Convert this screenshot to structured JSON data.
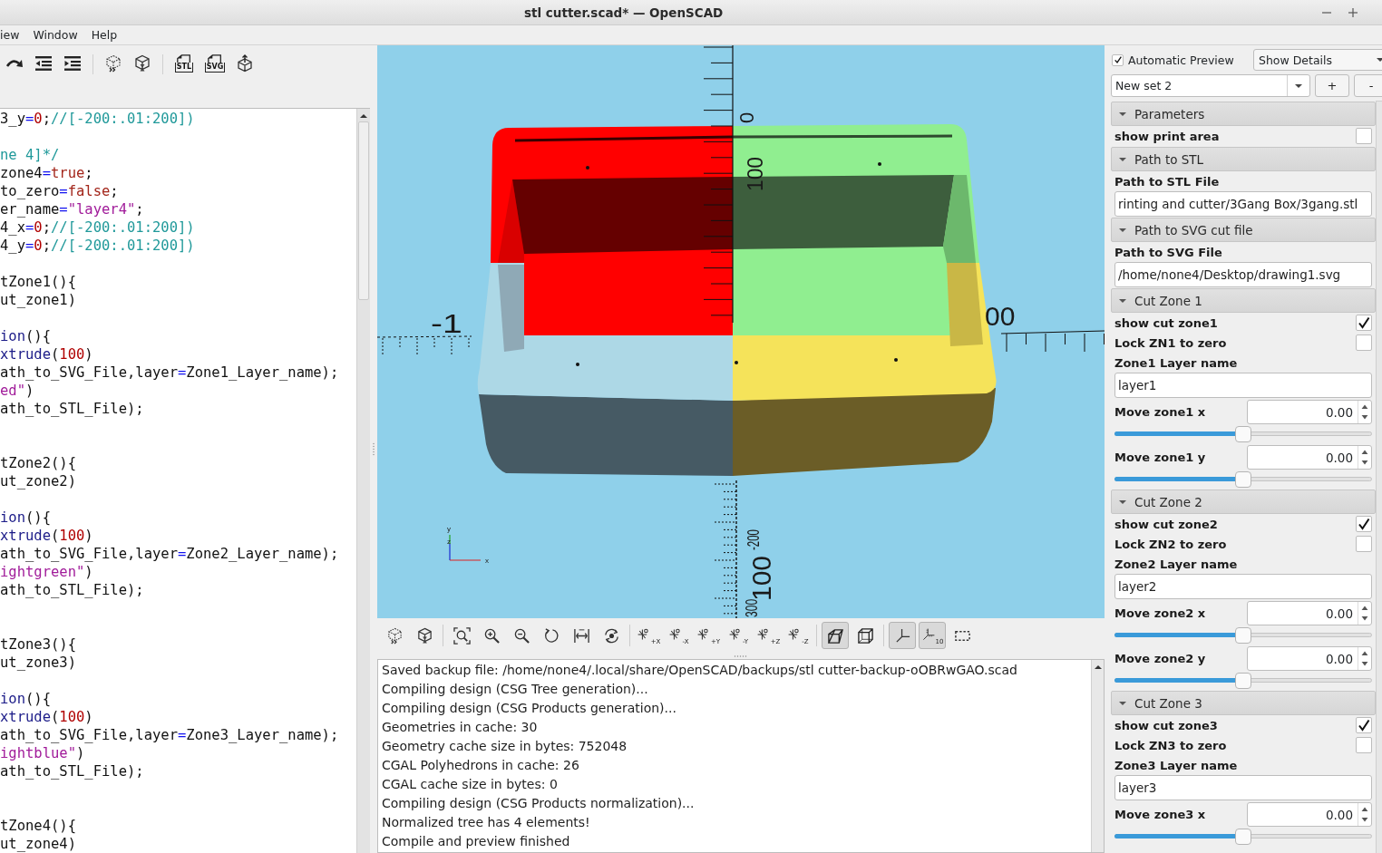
{
  "window": {
    "title": "stl cutter.scad* — OpenSCAD"
  },
  "menu": [
    {
      "label": "iew"
    },
    {
      "label": "Window"
    },
    {
      "label": "Help"
    }
  ],
  "editor_toolbar": {
    "export_labels": [
      "STL",
      "SVG"
    ]
  },
  "editor": {
    "lines": [
      {
        "kind": "code",
        "tokens": [
          {
            "kind": "plain",
            "text": "3_y"
          },
          {
            "kind": "operator",
            "text": "="
          },
          {
            "kind": "number",
            "text": "0"
          },
          {
            "kind": "plain",
            "text": ";"
          },
          {
            "kind": "comment",
            "text": "//[-200:.01:200])"
          }
        ]
      },
      {
        "kind": "blank"
      },
      {
        "kind": "code",
        "tokens": [
          {
            "kind": "comment",
            "text": "ne 4]*/"
          }
        ]
      },
      {
        "kind": "code",
        "tokens": [
          {
            "kind": "plain",
            "text": "zone4"
          },
          {
            "kind": "operator",
            "text": "="
          },
          {
            "kind": "keyword",
            "text": "true"
          },
          {
            "kind": "plain",
            "text": ";"
          }
        ]
      },
      {
        "kind": "code",
        "tokens": [
          {
            "kind": "plain",
            "text": "to_zero"
          },
          {
            "kind": "operator",
            "text": "="
          },
          {
            "kind": "keyword",
            "text": "false"
          },
          {
            "kind": "plain",
            "text": ";"
          }
        ]
      },
      {
        "kind": "code",
        "tokens": [
          {
            "kind": "plain",
            "text": "er_name"
          },
          {
            "kind": "operator",
            "text": "="
          },
          {
            "kind": "string",
            "text": "\"layer4\""
          },
          {
            "kind": "plain",
            "text": ";"
          }
        ]
      },
      {
        "kind": "code",
        "tokens": [
          {
            "kind": "plain",
            "text": "4_x"
          },
          {
            "kind": "operator",
            "text": "="
          },
          {
            "kind": "number",
            "text": "0"
          },
          {
            "kind": "plain",
            "text": ";"
          },
          {
            "kind": "comment",
            "text": "//[-200:.01:200])"
          }
        ]
      },
      {
        "kind": "code",
        "tokens": [
          {
            "kind": "plain",
            "text": "4_y"
          },
          {
            "kind": "operator",
            "text": "="
          },
          {
            "kind": "number",
            "text": "0"
          },
          {
            "kind": "plain",
            "text": ";"
          },
          {
            "kind": "comment",
            "text": "//[-200:.01:200])"
          }
        ]
      },
      {
        "kind": "blank"
      },
      {
        "kind": "code",
        "tokens": [
          {
            "kind": "plain",
            "text": "tZone1(){"
          }
        ]
      },
      {
        "kind": "code",
        "tokens": [
          {
            "kind": "plain",
            "text": "ut_zone1)"
          }
        ]
      },
      {
        "kind": "blank"
      },
      {
        "kind": "code",
        "tokens": [
          {
            "kind": "builtin",
            "text": "ion"
          },
          {
            "kind": "plain",
            "text": "(){"
          }
        ]
      },
      {
        "kind": "code",
        "tokens": [
          {
            "kind": "builtin",
            "text": "xtrude"
          },
          {
            "kind": "plain",
            "text": "("
          },
          {
            "kind": "number",
            "text": "100"
          },
          {
            "kind": "plain",
            "text": ")"
          }
        ]
      },
      {
        "kind": "code",
        "tokens": [
          {
            "kind": "plain",
            "text": "ath_to_SVG_File,layer"
          },
          {
            "kind": "operator",
            "text": "="
          },
          {
            "kind": "plain",
            "text": "Zone1_Layer_name);"
          }
        ]
      },
      {
        "kind": "code",
        "tokens": [
          {
            "kind": "string",
            "text": "ed\""
          },
          {
            "kind": "plain",
            "text": ")"
          }
        ]
      },
      {
        "kind": "code",
        "tokens": [
          {
            "kind": "plain",
            "text": "ath_to_STL_File);"
          }
        ]
      },
      {
        "kind": "blank"
      },
      {
        "kind": "blank"
      },
      {
        "kind": "code",
        "tokens": [
          {
            "kind": "plain",
            "text": "tZone2(){"
          }
        ]
      },
      {
        "kind": "code",
        "tokens": [
          {
            "kind": "plain",
            "text": "ut_zone2)"
          }
        ]
      },
      {
        "kind": "blank"
      },
      {
        "kind": "code",
        "tokens": [
          {
            "kind": "builtin",
            "text": "ion"
          },
          {
            "kind": "plain",
            "text": "(){"
          }
        ]
      },
      {
        "kind": "code",
        "tokens": [
          {
            "kind": "builtin",
            "text": "xtrude"
          },
          {
            "kind": "plain",
            "text": "("
          },
          {
            "kind": "number",
            "text": "100"
          },
          {
            "kind": "plain",
            "text": ")"
          }
        ]
      },
      {
        "kind": "code",
        "tokens": [
          {
            "kind": "plain",
            "text": "ath_to_SVG_File,layer"
          },
          {
            "kind": "operator",
            "text": "="
          },
          {
            "kind": "plain",
            "text": "Zone2_Layer_name);"
          }
        ]
      },
      {
        "kind": "code",
        "tokens": [
          {
            "kind": "string",
            "text": "ightgreen\""
          },
          {
            "kind": "plain",
            "text": ")"
          }
        ]
      },
      {
        "kind": "code",
        "tokens": [
          {
            "kind": "plain",
            "text": "ath_to_STL_File);"
          }
        ]
      },
      {
        "kind": "blank"
      },
      {
        "kind": "blank"
      },
      {
        "kind": "code",
        "tokens": [
          {
            "kind": "plain",
            "text": "tZone3(){"
          }
        ]
      },
      {
        "kind": "code",
        "tokens": [
          {
            "kind": "plain",
            "text": "ut_zone3)"
          }
        ]
      },
      {
        "kind": "blank"
      },
      {
        "kind": "code",
        "tokens": [
          {
            "kind": "builtin",
            "text": "ion"
          },
          {
            "kind": "plain",
            "text": "(){"
          }
        ]
      },
      {
        "kind": "code",
        "tokens": [
          {
            "kind": "builtin",
            "text": "xtrude"
          },
          {
            "kind": "plain",
            "text": "("
          },
          {
            "kind": "number",
            "text": "100"
          },
          {
            "kind": "plain",
            "text": ")"
          }
        ]
      },
      {
        "kind": "code",
        "tokens": [
          {
            "kind": "plain",
            "text": "ath_to_SVG_File,layer"
          },
          {
            "kind": "operator",
            "text": "="
          },
          {
            "kind": "plain",
            "text": "Zone3_Layer_name);"
          }
        ]
      },
      {
        "kind": "code",
        "tokens": [
          {
            "kind": "string",
            "text": "ightblue\""
          },
          {
            "kind": "plain",
            "text": ")"
          }
        ]
      },
      {
        "kind": "code",
        "tokens": [
          {
            "kind": "plain",
            "text": "ath_to_STL_File);"
          }
        ]
      },
      {
        "kind": "blank"
      },
      {
        "kind": "blank"
      },
      {
        "kind": "code",
        "tokens": [
          {
            "kind": "plain",
            "text": "tZone4(){"
          }
        ]
      },
      {
        "kind": "code",
        "tokens": [
          {
            "kind": "plain",
            "text": "ut_zone4)"
          }
        ]
      }
    ]
  },
  "viewport": {
    "axis_labels": [
      "0",
      "100",
      "-1",
      "00",
      "-200",
      "100",
      "300"
    ],
    "axes_letters": [
      "y",
      "z",
      "x"
    ]
  },
  "view_toolbar": [
    [
      {
        "kind": "preview",
        "pressed": false
      },
      {
        "kind": "render",
        "pressed": false
      }
    ],
    [
      {
        "kind": "view-all",
        "pressed": false
      },
      {
        "kind": "zoom-in",
        "pressed": false
      },
      {
        "kind": "zoom-out",
        "pressed": false
      },
      {
        "kind": "reset-view",
        "pressed": false
      },
      {
        "kind": "fit-width",
        "pressed": false
      },
      {
        "kind": "rotate-view",
        "pressed": false
      }
    ],
    [
      {
        "kind": "axis-view",
        "label": "+X",
        "pressed": false
      },
      {
        "kind": "axis-view",
        "label": "-X",
        "pressed": false
      },
      {
        "kind": "axis-view",
        "label": "+Y",
        "pressed": false
      },
      {
        "kind": "axis-view",
        "label": "-Y",
        "pressed": false
      },
      {
        "kind": "axis-view",
        "label": "+Z",
        "pressed": false
      },
      {
        "kind": "axis-view",
        "label": "-Z",
        "pressed": false
      }
    ],
    [
      {
        "kind": "perspective",
        "pressed": true
      },
      {
        "kind": "orthogonal",
        "pressed": false
      }
    ],
    [
      {
        "kind": "show-axes",
        "pressed": true
      },
      {
        "kind": "scale-markers",
        "label": "10",
        "pressed": true
      },
      {
        "kind": "show-edges",
        "pressed": false
      }
    ]
  ],
  "console": {
    "lines": [
      "Saved backup file: /home/none4/.local/share/OpenSCAD/backups/stl cutter-backup-oOBRwGAO.scad",
      "Compiling design (CSG Tree generation)...",
      "Compiling design (CSG Products generation)...",
      "Geometries in cache: 30",
      "Geometry cache size in bytes: 752048",
      "CGAL Polyhedrons in cache: 26",
      "CGAL cache size in bytes: 0",
      "Compiling design (CSG Products normalization)...",
      "Normalized tree has 4 elements!",
      "Compile and preview finished"
    ]
  },
  "top_controls": {
    "automatic_preview": {
      "label": "Automatic Preview",
      "checked": true
    },
    "details": {
      "value": "Show Details"
    },
    "preset": {
      "value": "New set 2"
    },
    "buttons": [
      "+",
      "-"
    ]
  },
  "parameters": [
    {
      "title": "Parameters",
      "expanded": true,
      "fields": [
        {
          "kind": "checkbox",
          "label": "show print area",
          "checked": false
        }
      ]
    },
    {
      "title": "Path to STL",
      "expanded": true,
      "fields": [
        {
          "kind": "text",
          "label": "Path to STL File",
          "value": "rinting and cutter/3Gang Box/3gang.stl"
        }
      ]
    },
    {
      "title": "Path to SVG cut file",
      "expanded": true,
      "fields": [
        {
          "kind": "text",
          "label": "Path to SVG File",
          "value": "/home/none4/Desktop/drawing1.svg"
        }
      ]
    },
    {
      "title": "Cut Zone 1",
      "expanded": true,
      "fields": [
        {
          "kind": "checkbox",
          "label": "show cut zone1",
          "checked": true
        },
        {
          "kind": "checkbox",
          "label": "Lock ZN1 to zero",
          "checked": false
        },
        {
          "kind": "text",
          "label": "Zone1 Layer name",
          "value": "layer1"
        },
        {
          "kind": "slider",
          "label": "Move zone1 x",
          "value": "0.00",
          "level": 0.5
        },
        {
          "kind": "slider",
          "label": "Move zone1 y",
          "value": "0.00",
          "level": 0.5
        }
      ]
    },
    {
      "title": "Cut Zone 2",
      "expanded": true,
      "fields": [
        {
          "kind": "checkbox",
          "label": "show cut zone2",
          "checked": true
        },
        {
          "kind": "checkbox",
          "label": "Lock ZN2 to zero",
          "checked": false
        },
        {
          "kind": "text",
          "label": "Zone2 Layer name",
          "value": "layer2"
        },
        {
          "kind": "slider",
          "label": "Move zone2 x",
          "value": "0.00",
          "level": 0.5
        },
        {
          "kind": "slider",
          "label": "Move zone2 y",
          "value": "0.00",
          "level": 0.5
        }
      ]
    },
    {
      "title": "Cut Zone 3",
      "expanded": true,
      "fields": [
        {
          "kind": "checkbox",
          "label": "show cut zone3",
          "checked": true
        },
        {
          "kind": "checkbox",
          "label": "Lock ZN3 to zero",
          "checked": false
        },
        {
          "kind": "text",
          "label": "Zone3 Layer name",
          "value": "layer3"
        },
        {
          "kind": "slider",
          "label": "Move zone3 x",
          "value": "0.00",
          "level": 0.5
        }
      ]
    }
  ]
}
